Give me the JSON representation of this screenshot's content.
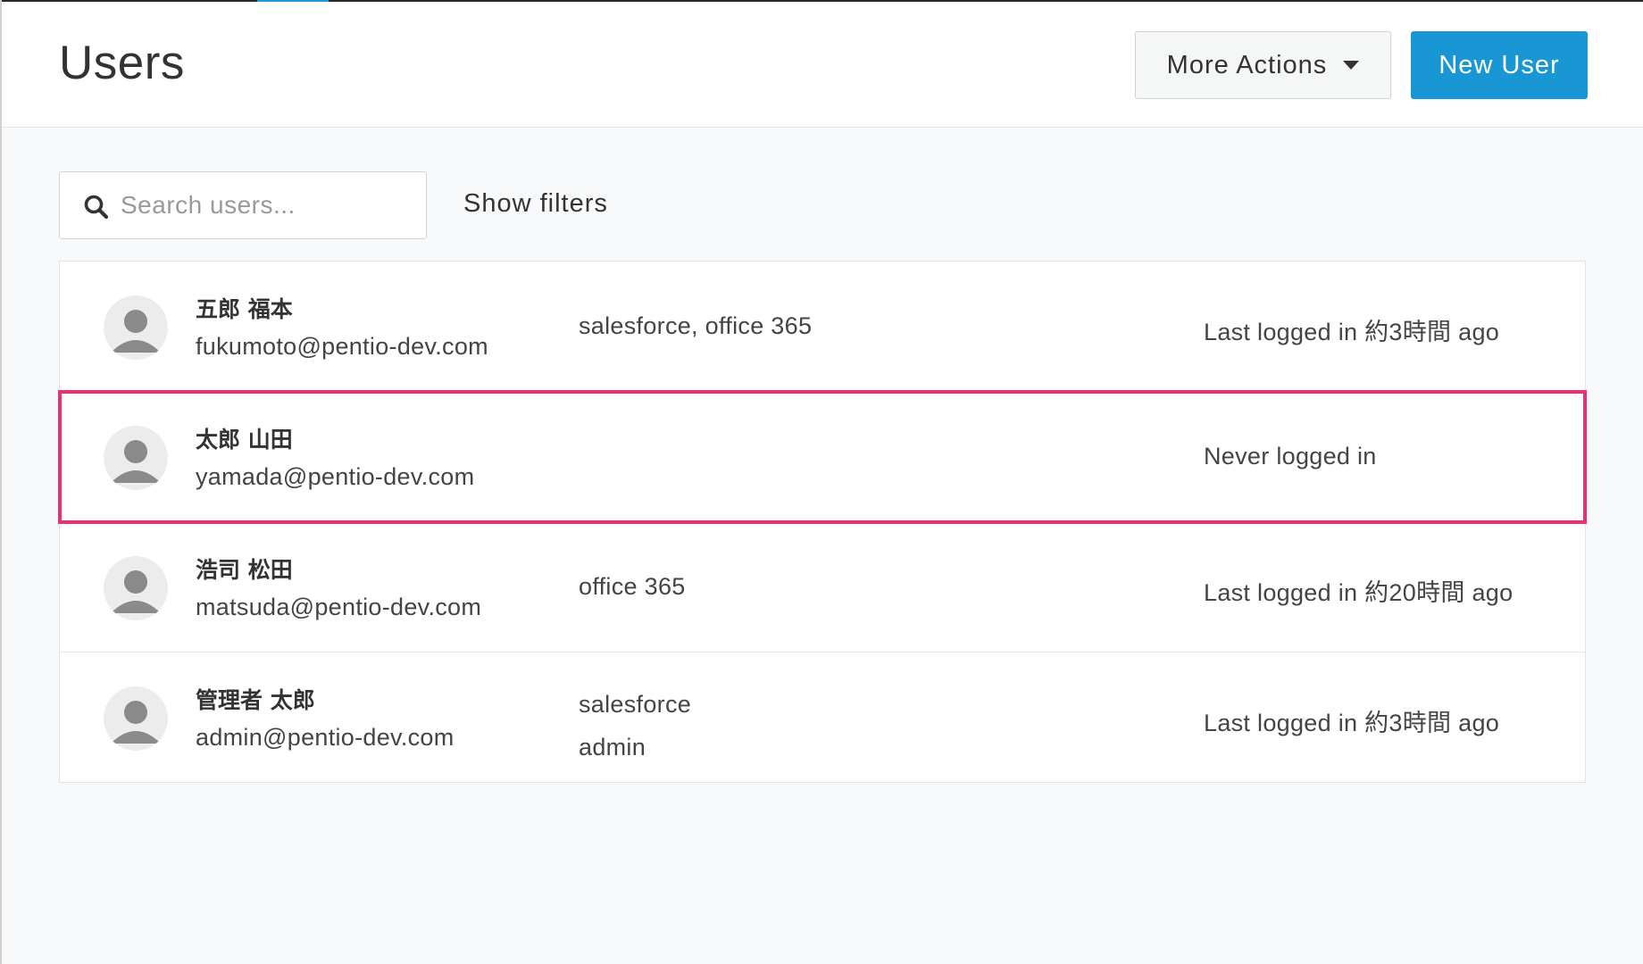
{
  "header": {
    "title": "Users",
    "more_actions_label": "More Actions",
    "new_user_label": "New User"
  },
  "search": {
    "placeholder": "Search users...",
    "value": ""
  },
  "filters": {
    "show_filters_label": "Show filters"
  },
  "colors": {
    "primary": "#1897d4",
    "highlight_outline": "#ee2f6e",
    "top_accent": "#1a9ad6"
  },
  "users": [
    {
      "name": "五郎 福本",
      "email": "fukumoto@pentio-dev.com",
      "groups": [
        "salesforce, office 365"
      ],
      "status": "Last logged in 約3時間 ago",
      "highlighted": false
    },
    {
      "name": "太郎 山田",
      "email": "yamada@pentio-dev.com",
      "groups": [],
      "status": "Never logged in",
      "highlighted": true
    },
    {
      "name": "浩司 松田",
      "email": "matsuda@pentio-dev.com",
      "groups": [
        "office 365"
      ],
      "status": "Last logged in 約20時間 ago",
      "highlighted": false
    },
    {
      "name": "管理者 太郎",
      "email": "admin@pentio-dev.com",
      "groups": [
        "salesforce",
        "admin"
      ],
      "status": "Last logged in 約3時間 ago",
      "highlighted": false
    }
  ]
}
